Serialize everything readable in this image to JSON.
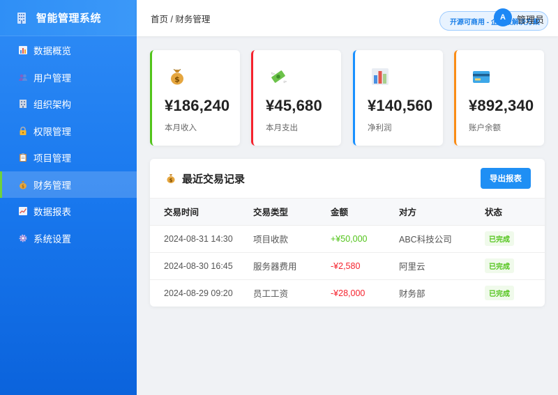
{
  "app": {
    "title": "智能管理系统"
  },
  "sidebar": {
    "items": [
      {
        "label": "数据概览",
        "icon": "bar-chart-icon"
      },
      {
        "label": "用户管理",
        "icon": "users-icon"
      },
      {
        "label": "组织架构",
        "icon": "building-icon"
      },
      {
        "label": "权限管理",
        "icon": "lock-icon"
      },
      {
        "label": "项目管理",
        "icon": "clipboard-icon"
      },
      {
        "label": "财务管理",
        "icon": "money-bag-icon",
        "active": true
      },
      {
        "label": "数据报表",
        "icon": "line-chart-icon"
      },
      {
        "label": "系统设置",
        "icon": "gear-icon"
      }
    ]
  },
  "header": {
    "breadcrumb": "首页 / 财务管理",
    "promo": "开源可商用 - 企业级解决方案",
    "avatar_initial": "A",
    "username": "管理员"
  },
  "stats": [
    {
      "value": "¥186,240",
      "label": "本月收入",
      "color": "#52c41a",
      "icon": "money-bag-icon"
    },
    {
      "value": "¥45,680",
      "label": "本月支出",
      "color": "#f5222d",
      "icon": "money-wings-icon"
    },
    {
      "value": "¥140,560",
      "label": "净利润",
      "color": "#1890ff",
      "icon": "bar-chart-icon"
    },
    {
      "value": "¥892,340",
      "label": "账户余额",
      "color": "#fa8c16",
      "icon": "credit-card-icon"
    }
  ],
  "transactions": {
    "title": "最近交易记录",
    "export_label": "导出报表",
    "columns": [
      "交易时间",
      "交易类型",
      "金额",
      "对方",
      "状态"
    ],
    "rows": [
      {
        "time": "2024-08-31 14:30",
        "type": "项目收款",
        "amount": "+¥50,000",
        "party": "ABC科技公司",
        "status": "已完成"
      },
      {
        "time": "2024-08-30 16:45",
        "type": "服务器费用",
        "amount": "-¥2,580",
        "party": "阿里云",
        "status": "已完成"
      },
      {
        "time": "2024-08-29 09:20",
        "type": "员工工资",
        "amount": "-¥28,000",
        "party": "财务部",
        "status": "已完成"
      }
    ]
  },
  "colors": {
    "accent": "#1f8ff4",
    "positive": "#52c41a",
    "negative": "#f5222d"
  }
}
